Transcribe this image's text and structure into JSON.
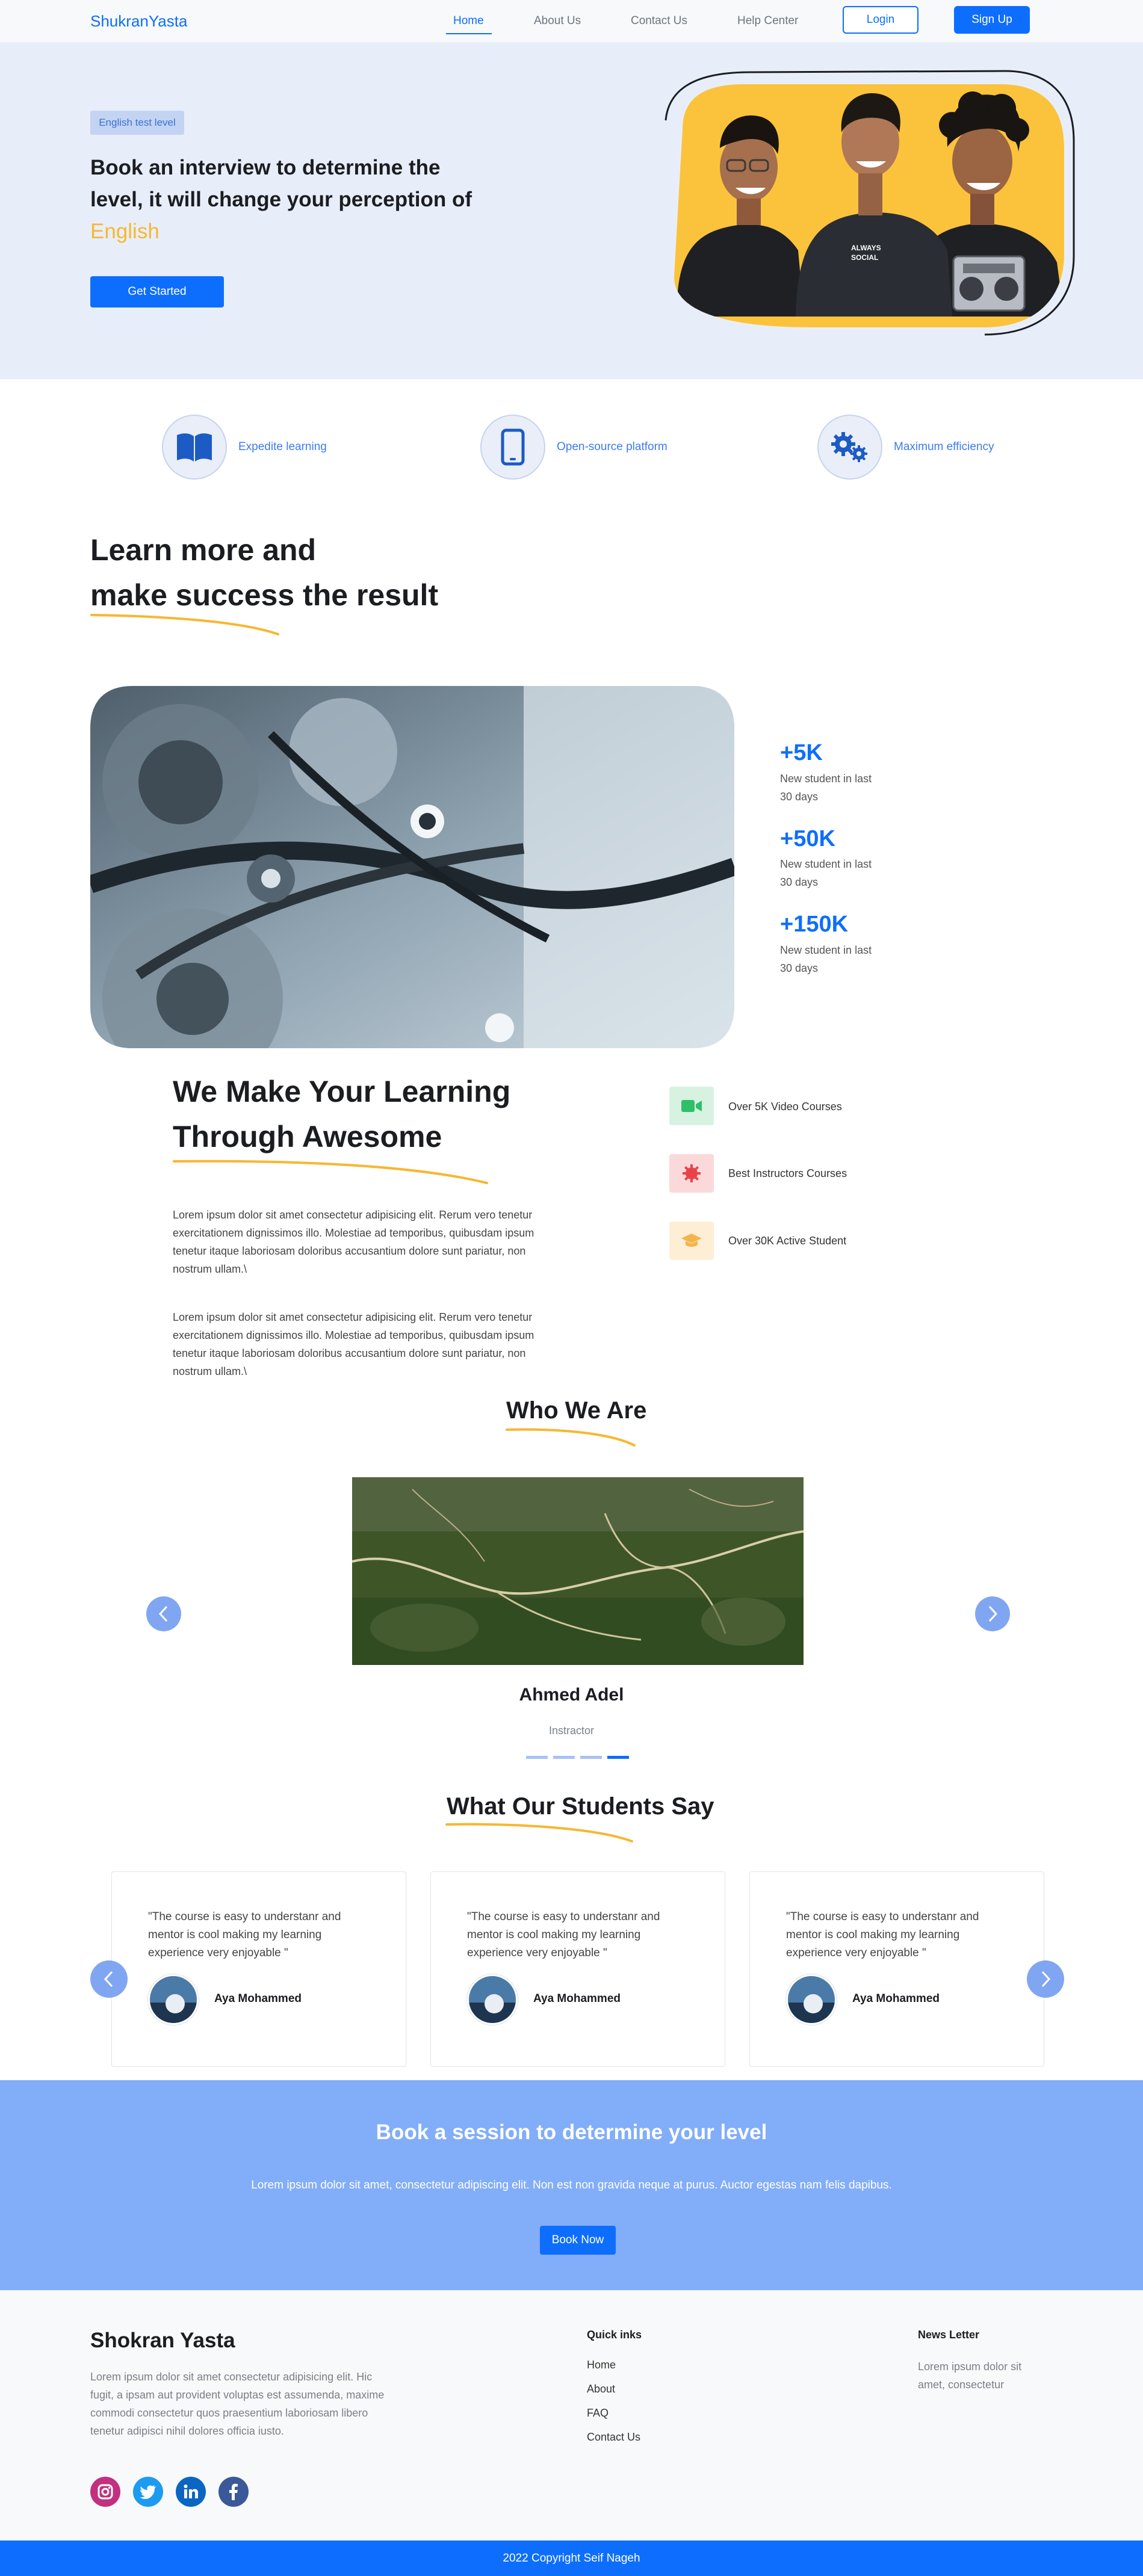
{
  "nav": {
    "brand": "ShukranYasta",
    "links": [
      "Home",
      "About Us",
      "Contact Us",
      "Help Center"
    ],
    "login": "Login",
    "signup": "Sign Up"
  },
  "hero": {
    "badge": "English test level",
    "title_line1": "Book an interview to determine the",
    "title_line2": "level, it will change your perception of",
    "title_accent": "English",
    "cta": "Get Started"
  },
  "features": [
    {
      "label": "Expedite learning",
      "icon": "book-icon"
    },
    {
      "label": "Open-source platform",
      "icon": "phone-icon"
    },
    {
      "label": "Maximum efficiency",
      "icon": "gears-icon"
    }
  ],
  "learn": {
    "title_line1": "Learn more and",
    "title_line2": "make success the result",
    "stats": [
      {
        "value": "+5K",
        "text": "New student in last 30 days"
      },
      {
        "value": "+50K",
        "text": "New student in last 30 days"
      },
      {
        "value": "+150K",
        "text": "New student in last 30 days"
      }
    ]
  },
  "awesome": {
    "title_line1": "We Make Your Learning",
    "title_line2": "Through Awesome",
    "para1": "Lorem ipsum dolor sit amet consectetur adipisicing elit. Rerum vero tenetur exercitationem dignissimos illo. Molestiae ad temporibus, quibusdam ipsum tenetur itaque laboriosam doloribus accusantium dolore sunt pariatur, non nostrum ullam.\\",
    "para2": "Lorem ipsum dolor sit amet consectetur adipisicing elit. Rerum vero tenetur exercitationem dignissimos illo. Molestiae ad temporibus, quibusdam ipsum tenetur itaque laboriosam doloribus accusantium dolore sunt pariatur, non nostrum ullam.\\",
    "chips": [
      {
        "label": "Over 5K Video Courses",
        "bg": "#d7f2e1",
        "color": "#2fbf6a"
      },
      {
        "label": "Best Instructors Courses",
        "bg": "#fbd9da",
        "color": "#e8434c"
      },
      {
        "label": "Over 30K Active Student",
        "bg": "#fdeed6",
        "color": "#f3b54a"
      }
    ]
  },
  "who": {
    "title": "Who We Are",
    "name": "Ahmed Adel",
    "role": "Instractor",
    "slide_count": 4,
    "active_slide": 4
  },
  "students": {
    "title": "What Our Students Say",
    "items": [
      {
        "quote": "\"The course is easy to understanr and mentor is cool making my learning experience very enjoyable \"",
        "name": "Aya Mohammed"
      },
      {
        "quote": "\"The course is easy to understanr and mentor is cool making my learning experience very enjoyable \"",
        "name": "Aya Mohammed"
      },
      {
        "quote": "\"The course is easy to understanr and mentor is cool making my learning experience very enjoyable \"",
        "name": "Aya Mohammed"
      }
    ]
  },
  "cta": {
    "title": "Book a session to determine your level",
    "text": "Lorem ipsum dolor sit amet, consectetur adipiscing elit. Non est non gravida neque at purus. Auctor egestas nam felis dapibus.",
    "button": "Book Now"
  },
  "footer": {
    "brand": "Shokran Yasta",
    "text": "Lorem ipsum dolor sit amet consectetur adipisicing elit. Hic fugit, a ipsam aut provident voluptas est assumenda, maxime commodi consectetur quos praesentium laboriosam libero tenetur adipisci nihil dolores officia iusto.",
    "quick_title": "Quick inks",
    "quick_links": [
      "Home",
      "About",
      "FAQ",
      "Contact Us"
    ],
    "news_title": "News Letter",
    "news_text": "Lorem ipsum dolor sit amet, consectetur",
    "copyright": "2022 Copyright Seif Nageh"
  },
  "colors": {
    "primary": "#0d6efd",
    "accent": "#f7b731",
    "hero_bg": "#e8eef9",
    "cta_bg": "#82adf9"
  }
}
